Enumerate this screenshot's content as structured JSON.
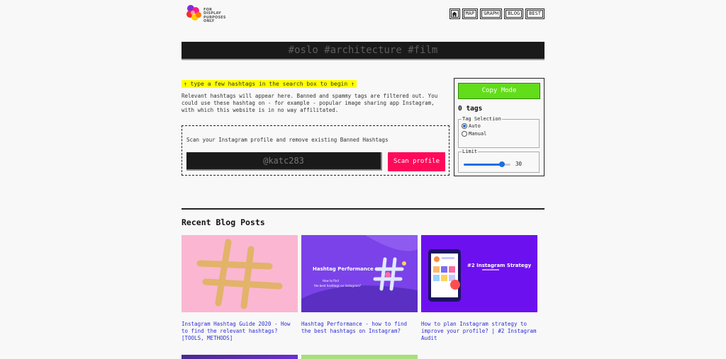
{
  "header": {
    "logo_lines": [
      "FOR",
      "DISPLAY",
      "PURPOSES",
      "ONLY"
    ],
    "nav": [
      {
        "icon": "home-icon"
      },
      {
        "label": "MAP"
      },
      {
        "label": "GRAPH"
      },
      {
        "label": "BLOG"
      },
      {
        "label": "BEST"
      }
    ]
  },
  "search": {
    "placeholder": "#oslo #architecture #film"
  },
  "intro": {
    "hint": "↑ type a few hashtags in the search box to begin ↑",
    "description": "Relevant hashtags will appear here. Banned and spammy tags are filtered out. You could use these hashtag on - for example - popular image sharing app Instagram, with which this website is in no way affilitated."
  },
  "scan": {
    "label": "Scan your Instagram profile and remove existing Banned Hashtags",
    "input_placeholder": "@katc283",
    "button": "Scan profile"
  },
  "panel": {
    "copy_button": "Copy Mode",
    "tag_count": "0 tags",
    "selection_legend": "Tag Selection",
    "options": [
      {
        "label": "Auto",
        "selected": true
      },
      {
        "label": "Manual",
        "selected": false
      }
    ],
    "limit_legend": "Limit",
    "limit_value": "30",
    "limit_fraction": 0.82
  },
  "blog": {
    "title": "Recent Blog Posts",
    "posts": [
      {
        "caption": "Instagram Hashtag Guide 2020 - How to find the relevant hashtags? [TOOLS, METHODS]"
      },
      {
        "caption": "Hashtag Performance - how to find the best hashtags on Instagram?",
        "thumb_title": "Hashtag Performance",
        "thumb_sub1": "How to find",
        "thumb_sub2": "the best hashtags on Instagram?"
      },
      {
        "caption": "How to plan Instagram strategy to improve your profile? | #2 Instagram Audit",
        "thumb_title": "#2 Instagram Strategy"
      }
    ]
  },
  "colors": {
    "accent_green": "#62dd1a",
    "scan_pink": "#ff0a5a",
    "hint_yellow": "#ffff00",
    "link_blue": "#2b2bd6"
  }
}
